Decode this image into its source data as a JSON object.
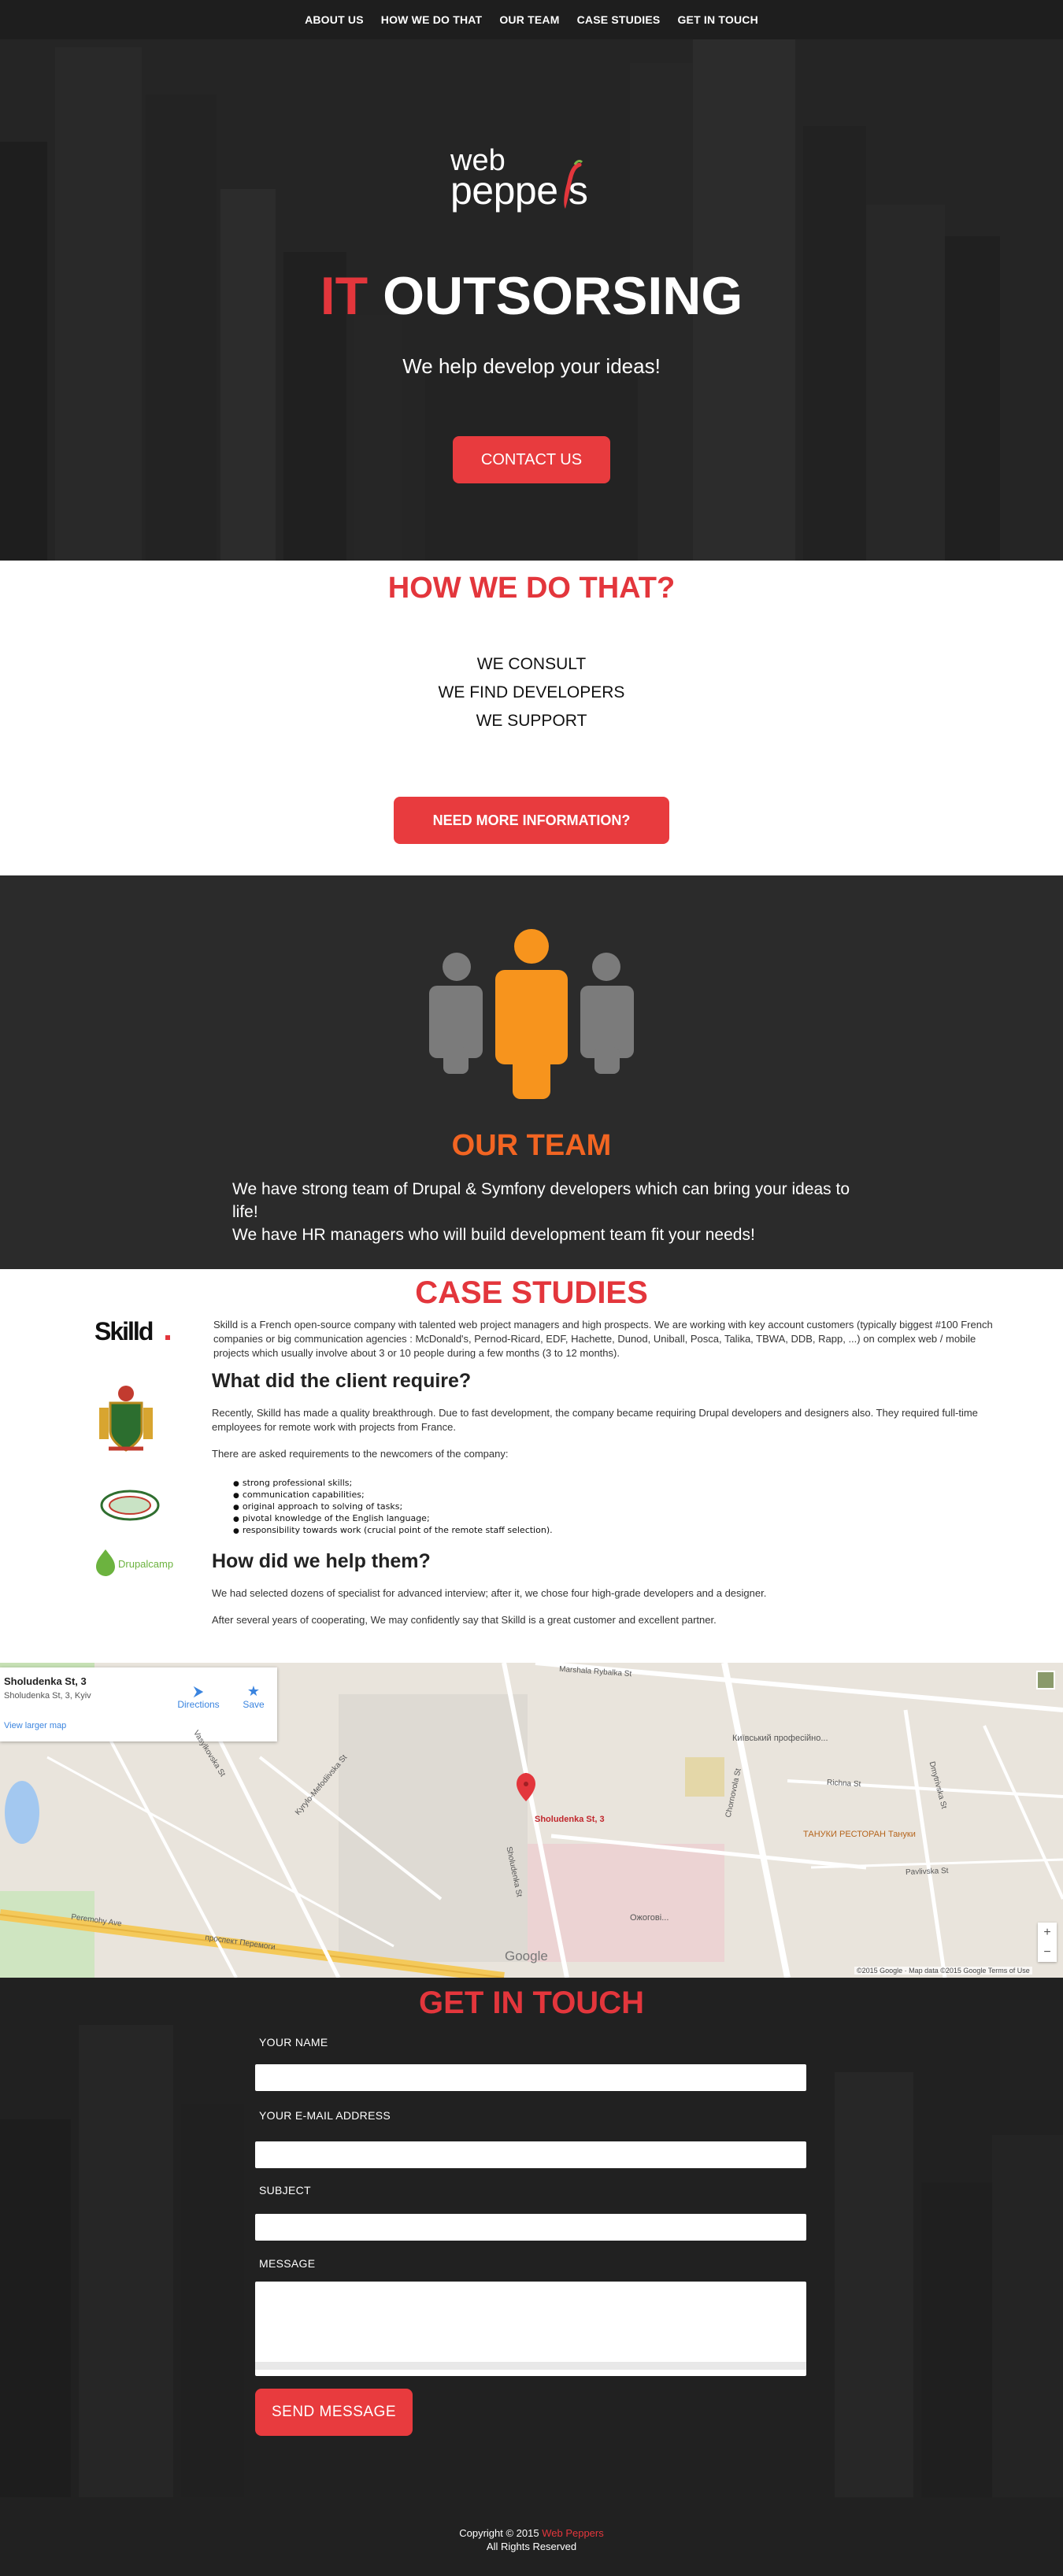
{
  "nav": {
    "items": [
      "ABOUT US",
      "HOW WE DO THAT",
      "OUR TEAM",
      "CASE STUDIES",
      "GET IN TOUCH"
    ]
  },
  "hero": {
    "logo_line1": "web",
    "logo_line2": "peppe s",
    "title_highlight": "IT",
    "title_rest": " OUTSORSING",
    "subtitle": "We help develop your ideas!",
    "cta_label": "CONTACT US"
  },
  "how": {
    "title": "HOW WE DO THAT?",
    "items": [
      "WE CONSULT",
      "WE FIND DEVELOPERS",
      "WE SUPPORT"
    ],
    "cta_label": "NEED MORE INFORMATION?"
  },
  "team": {
    "title": "OUR TEAM",
    "line1": "We have strong team of Drupal & Symfony developers which can bring your ideas to life!",
    "line2": "We have HR managers who will build development team fit your needs!",
    "colors": {
      "member": "#7b7b7b",
      "leader": "#f7941d",
      "title": "#f26522"
    }
  },
  "cases": {
    "title": "CASE STUDIES",
    "logos": [
      "Skilld.",
      "Drupalcamp"
    ],
    "intro": "Skilld is a French open-source company with talented web project managers and high prospects. We are working with key account customers (typically biggest #100 French companies or big communication agencies : McDonald's, Pernod-Ricard, EDF, Hachette, Dunod, Uniball, Posca, Talika, TBWA, DDB, Rapp, ...) on complex web / mobile projects which usually involve about 3 or 10 people during a few months (3 to 12 months).",
    "heading1": "What did the client require?",
    "p1": "Recently, Skilld has made a quality breakthrough. Due to fast development, the company became requiring Drupal developers and designers also. They required full-time employees for remote work with projects from France.",
    "p2": "There are asked requirements to the newcomers of the company:",
    "requirements": [
      "strong professional skills;",
      "communication capabilities;",
      "original approach to solving of tasks;",
      "pivotal knowledge of the English language;",
      "responsibility towards work (crucial point of the remote staff selection)."
    ],
    "heading2": "How did we help them?",
    "p3": "We had selected dozens of specialist for advanced interview; after it, we chose four high-grade developers and a designer.",
    "p4": "After several years of cooperating, We may confidently say that Skilld is a great customer and excellent partner."
  },
  "map": {
    "card_title": "Sholudenka St, 3",
    "card_address": "Sholudenka St, 3, Kyiv",
    "directions": "Directions",
    "save": "Save",
    "larger_map": "View larger map",
    "pin_label": "Sholudenka St, 3",
    "place1": "Київський професійно...",
    "place2": "ТАНУКИ РЕСТОРАН Тануки",
    "place3": "Ожогові...",
    "streets": [
      "Marshala Rybalka St",
      "Vasylkovska St",
      "Dmytrivska St",
      "Peremohy Ave",
      "проспект Перемоги",
      "Sholudenka St",
      "Pavlivska St",
      "Richna St",
      "Kyrylo-Mefodiivska St",
      "Chornovola St"
    ],
    "google": "Google",
    "attribution": "©2015 Google · Map data ©2015 Google    Terms of Use",
    "zoom_in": "+",
    "zoom_out": "−"
  },
  "contact": {
    "title": "GET IN TOUCH",
    "name_label": "YOUR NAME",
    "email_label": "YOUR E-MAIL ADDRESS",
    "subject_label": "SUBJECT",
    "message_label": "MESSAGE",
    "submit_label": "SEND MESSAGE"
  },
  "footer": {
    "copy_prefix": "Copyright © 2015 ",
    "copy_brand": "Web Peppers",
    "rights": "All Rights Reserved"
  },
  "colors": {
    "accent_red": "#e83b3e",
    "dark_bg": "#2b2b2b",
    "orange": "#f7941d"
  }
}
